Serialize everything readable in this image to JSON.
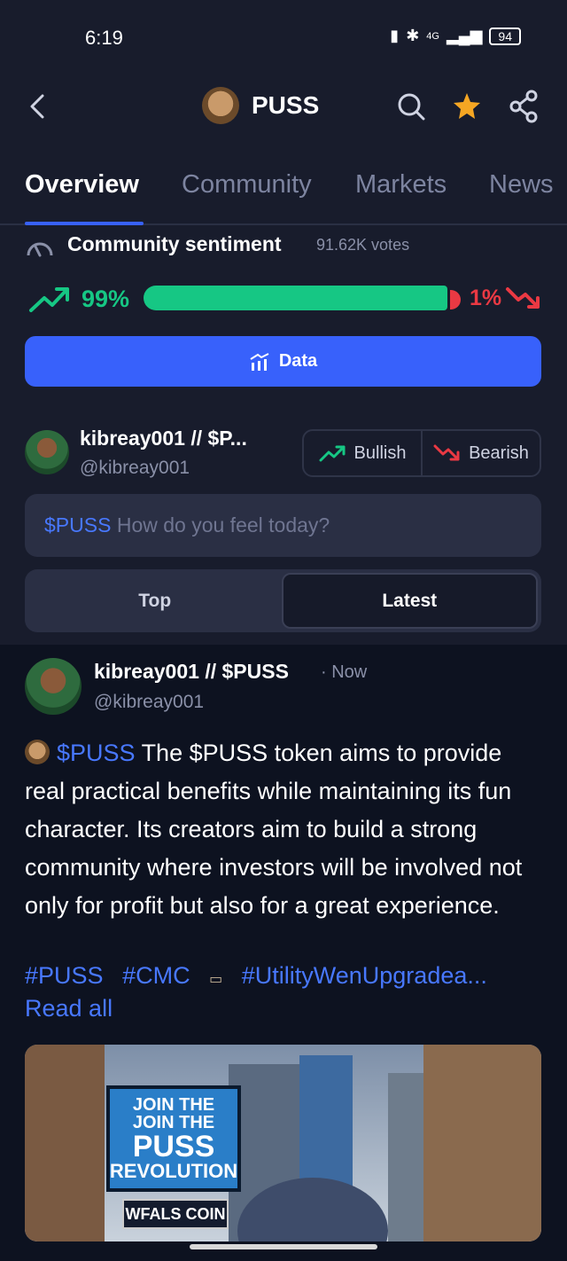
{
  "status": {
    "time": "6:19",
    "network": "4G",
    "battery": "94"
  },
  "header": {
    "title": "PUSS"
  },
  "tabs": [
    {
      "label": "Overview"
    },
    {
      "label": "Community"
    },
    {
      "label": "Markets"
    },
    {
      "label": "News"
    }
  ],
  "sentiment": {
    "title": "Community sentiment",
    "votes": "91.62K votes",
    "bullish_pct": "99%",
    "bearish_pct": "1%",
    "bullish_fraction": 0.99
  },
  "data_button": {
    "label": "Data"
  },
  "composer": {
    "user_name": "kibreay001 // $P...",
    "user_handle": "@kibreay001",
    "bullish_label": "Bullish",
    "bearish_label": "Bearish",
    "input_tag": "$PUSS",
    "input_placeholder": "How do you feel today?"
  },
  "sort": {
    "options": [
      "Top",
      "Latest"
    ],
    "selected": "Latest"
  },
  "post": {
    "author": "kibreay001 // $PUSS",
    "time": "· Now",
    "handle": "@kibreay001",
    "cashtag": "$PUSS",
    "text": "The $PUSS token aims to provide real practical benefits while maintaining its fun character. Its creators aim to build a strong community where investors will be involved not only for profit but also for a great experience.",
    "hashtags": [
      "#PUSS",
      "#CMC",
      "#UtilityWenUpgradea..."
    ],
    "read_all": "Read all",
    "image": {
      "billboard_line1": "JOIN THE",
      "billboard_line2": "JOIN THE",
      "billboard_line3": "PUSS",
      "billboard_line4": "REVOLUTION",
      "sign_text": "WFALS COIN"
    }
  },
  "colors": {
    "accent": "#3861fb",
    "bull": "#16c784",
    "bear": "#ea3943",
    "link": "#4878ff"
  }
}
